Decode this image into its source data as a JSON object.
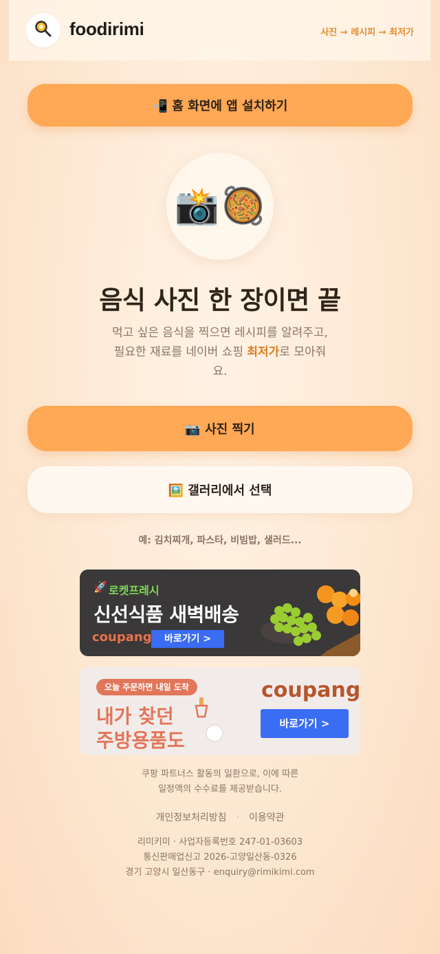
{
  "header": {
    "brand": "foodirimi",
    "flow": "사진 → 레시피 → 최저가"
  },
  "install_button": {
    "label": "📲 홈 화면에 앱 설치하기"
  },
  "hero": {
    "emoji_camera": "📸",
    "emoji_dish": "🥘",
    "headline": "음식 사진 한 장이면 끝",
    "desc_line1": "먹고 싶은 음식을 찍으면 레시피를 알려주고,",
    "desc_line2_pre": "필요한 재료를 네이버 쇼핑 ",
    "desc_highlight": "최저가",
    "desc_line2_post": "로 모아줘",
    "desc_line3": "요."
  },
  "photo_button": {
    "label": "📷 사진 찍기"
  },
  "gallery_button": {
    "label": "🖼️ 갤러리에서 선택"
  },
  "example_text": "예: 김치찌개, 파스타, 비빔밥, 샐러드...",
  "ads": [
    {
      "tag": "로켓프레시",
      "title": "신선식품 새벽배송",
      "brand": "coupang",
      "cta": "바로가기 >"
    },
    {
      "badge": "오늘 주문하면 내일 도착",
      "title_line1": "내가 찾던",
      "title_line2": "주방용품도",
      "brand": "coupang",
      "cta": "바로가기 >"
    }
  ],
  "partners_notice": {
    "line1": "쿠팡 파트너스 활동의 일환으로, 이에 따른",
    "line2": "일정액의 수수료를 제공받습니다."
  },
  "footer_links": {
    "privacy": "개인정보처리방침",
    "terms": "이용약관",
    "separator": "·"
  },
  "company": {
    "line1": "리미키미 · 사업자등록번호 247-01-03603",
    "line2": "통신판매업신고 2026-고양일산동-0326",
    "line3": "경기 고양시 일산동구 · enquiry@rimikimi.com"
  },
  "colors": {
    "accent": "#ffa855",
    "highlight": "#e07a1c",
    "coupang_blue": "#3a6cf4"
  }
}
